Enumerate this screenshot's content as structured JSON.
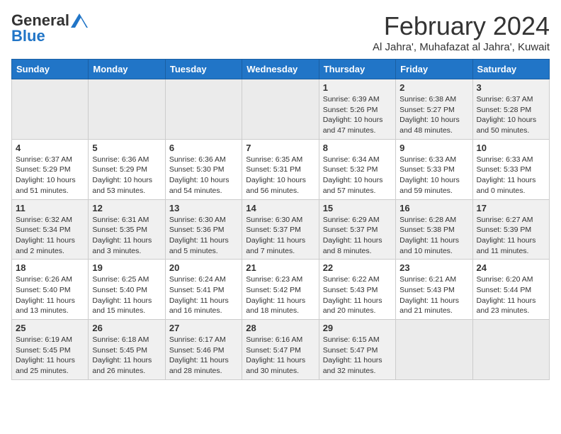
{
  "logo": {
    "general": "General",
    "blue": "Blue"
  },
  "header": {
    "month_title": "February 2024",
    "subtitle": "Al Jahra', Muhafazat al Jahra', Kuwait"
  },
  "weekdays": [
    "Sunday",
    "Monday",
    "Tuesday",
    "Wednesday",
    "Thursday",
    "Friday",
    "Saturday"
  ],
  "weeks": [
    [
      {
        "day": "",
        "info": ""
      },
      {
        "day": "",
        "info": ""
      },
      {
        "day": "",
        "info": ""
      },
      {
        "day": "",
        "info": ""
      },
      {
        "day": "1",
        "info": "Sunrise: 6:39 AM\nSunset: 5:26 PM\nDaylight: 10 hours\nand 47 minutes."
      },
      {
        "day": "2",
        "info": "Sunrise: 6:38 AM\nSunset: 5:27 PM\nDaylight: 10 hours\nand 48 minutes."
      },
      {
        "day": "3",
        "info": "Sunrise: 6:37 AM\nSunset: 5:28 PM\nDaylight: 10 hours\nand 50 minutes."
      }
    ],
    [
      {
        "day": "4",
        "info": "Sunrise: 6:37 AM\nSunset: 5:29 PM\nDaylight: 10 hours\nand 51 minutes."
      },
      {
        "day": "5",
        "info": "Sunrise: 6:36 AM\nSunset: 5:29 PM\nDaylight: 10 hours\nand 53 minutes."
      },
      {
        "day": "6",
        "info": "Sunrise: 6:36 AM\nSunset: 5:30 PM\nDaylight: 10 hours\nand 54 minutes."
      },
      {
        "day": "7",
        "info": "Sunrise: 6:35 AM\nSunset: 5:31 PM\nDaylight: 10 hours\nand 56 minutes."
      },
      {
        "day": "8",
        "info": "Sunrise: 6:34 AM\nSunset: 5:32 PM\nDaylight: 10 hours\nand 57 minutes."
      },
      {
        "day": "9",
        "info": "Sunrise: 6:33 AM\nSunset: 5:33 PM\nDaylight: 10 hours\nand 59 minutes."
      },
      {
        "day": "10",
        "info": "Sunrise: 6:33 AM\nSunset: 5:33 PM\nDaylight: 11 hours\nand 0 minutes."
      }
    ],
    [
      {
        "day": "11",
        "info": "Sunrise: 6:32 AM\nSunset: 5:34 PM\nDaylight: 11 hours\nand 2 minutes."
      },
      {
        "day": "12",
        "info": "Sunrise: 6:31 AM\nSunset: 5:35 PM\nDaylight: 11 hours\nand 3 minutes."
      },
      {
        "day": "13",
        "info": "Sunrise: 6:30 AM\nSunset: 5:36 PM\nDaylight: 11 hours\nand 5 minutes."
      },
      {
        "day": "14",
        "info": "Sunrise: 6:30 AM\nSunset: 5:37 PM\nDaylight: 11 hours\nand 7 minutes."
      },
      {
        "day": "15",
        "info": "Sunrise: 6:29 AM\nSunset: 5:37 PM\nDaylight: 11 hours\nand 8 minutes."
      },
      {
        "day": "16",
        "info": "Sunrise: 6:28 AM\nSunset: 5:38 PM\nDaylight: 11 hours\nand 10 minutes."
      },
      {
        "day": "17",
        "info": "Sunrise: 6:27 AM\nSunset: 5:39 PM\nDaylight: 11 hours\nand 11 minutes."
      }
    ],
    [
      {
        "day": "18",
        "info": "Sunrise: 6:26 AM\nSunset: 5:40 PM\nDaylight: 11 hours\nand 13 minutes."
      },
      {
        "day": "19",
        "info": "Sunrise: 6:25 AM\nSunset: 5:40 PM\nDaylight: 11 hours\nand 15 minutes."
      },
      {
        "day": "20",
        "info": "Sunrise: 6:24 AM\nSunset: 5:41 PM\nDaylight: 11 hours\nand 16 minutes."
      },
      {
        "day": "21",
        "info": "Sunrise: 6:23 AM\nSunset: 5:42 PM\nDaylight: 11 hours\nand 18 minutes."
      },
      {
        "day": "22",
        "info": "Sunrise: 6:22 AM\nSunset: 5:43 PM\nDaylight: 11 hours\nand 20 minutes."
      },
      {
        "day": "23",
        "info": "Sunrise: 6:21 AM\nSunset: 5:43 PM\nDaylight: 11 hours\nand 21 minutes."
      },
      {
        "day": "24",
        "info": "Sunrise: 6:20 AM\nSunset: 5:44 PM\nDaylight: 11 hours\nand 23 minutes."
      }
    ],
    [
      {
        "day": "25",
        "info": "Sunrise: 6:19 AM\nSunset: 5:45 PM\nDaylight: 11 hours\nand 25 minutes."
      },
      {
        "day": "26",
        "info": "Sunrise: 6:18 AM\nSunset: 5:45 PM\nDaylight: 11 hours\nand 26 minutes."
      },
      {
        "day": "27",
        "info": "Sunrise: 6:17 AM\nSunset: 5:46 PM\nDaylight: 11 hours\nand 28 minutes."
      },
      {
        "day": "28",
        "info": "Sunrise: 6:16 AM\nSunset: 5:47 PM\nDaylight: 11 hours\nand 30 minutes."
      },
      {
        "day": "29",
        "info": "Sunrise: 6:15 AM\nSunset: 5:47 PM\nDaylight: 11 hours\nand 32 minutes."
      },
      {
        "day": "",
        "info": ""
      },
      {
        "day": "",
        "info": ""
      }
    ]
  ]
}
